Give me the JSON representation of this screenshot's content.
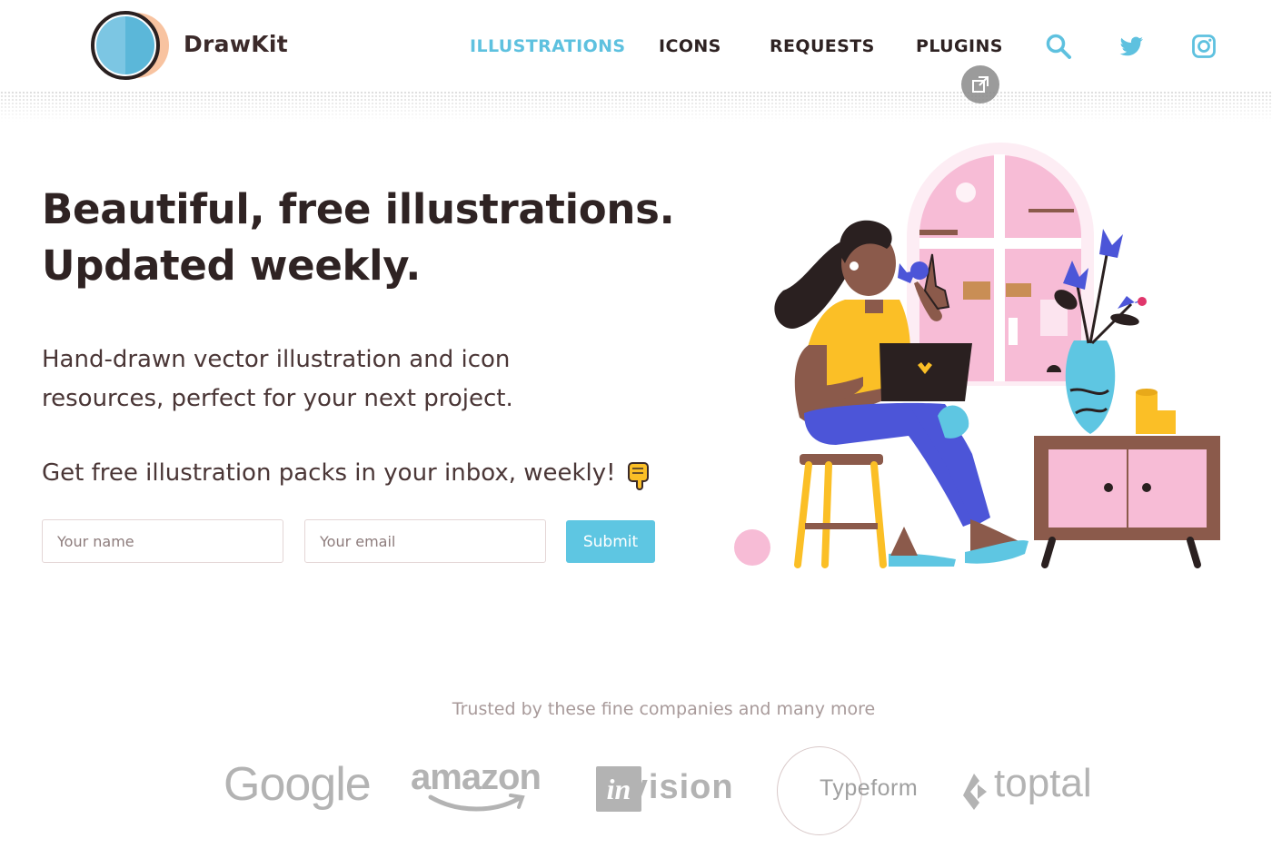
{
  "brand": {
    "name": "DrawKit"
  },
  "nav": {
    "items": [
      {
        "label": "ILLUSTRATIONS",
        "active": true
      },
      {
        "label": "ICONS",
        "active": false
      },
      {
        "label": "REQUESTS",
        "active": false
      },
      {
        "label": "PLUGINS",
        "active": false
      }
    ],
    "icons": [
      "search-icon",
      "twitter-icon",
      "instagram-icon"
    ]
  },
  "hero": {
    "title_line1": "Beautiful, free illustrations.",
    "title_line2": "Updated weekly.",
    "subtitle_line1": "Hand-drawn vector illustration and icon",
    "subtitle_line2": "resources, perfect for your next project.",
    "cta": "Get free illustration packs in your inbox, weekly!"
  },
  "form": {
    "name_placeholder": "Your name",
    "email_placeholder": "Your email",
    "submit_label": "Submit"
  },
  "trusted": {
    "heading": "Trusted by these fine companies and many more",
    "companies": [
      "Google",
      "amazon",
      "invision",
      "Typeform",
      "toptal"
    ]
  },
  "colors": {
    "accent": "#5ec1df",
    "text": "#2f2323",
    "illustration_pink": "#f7bcd6",
    "illustration_yellow": "#fbbf26",
    "illustration_blue": "#4c55d8",
    "illustration_brown": "#8b5a4b"
  }
}
